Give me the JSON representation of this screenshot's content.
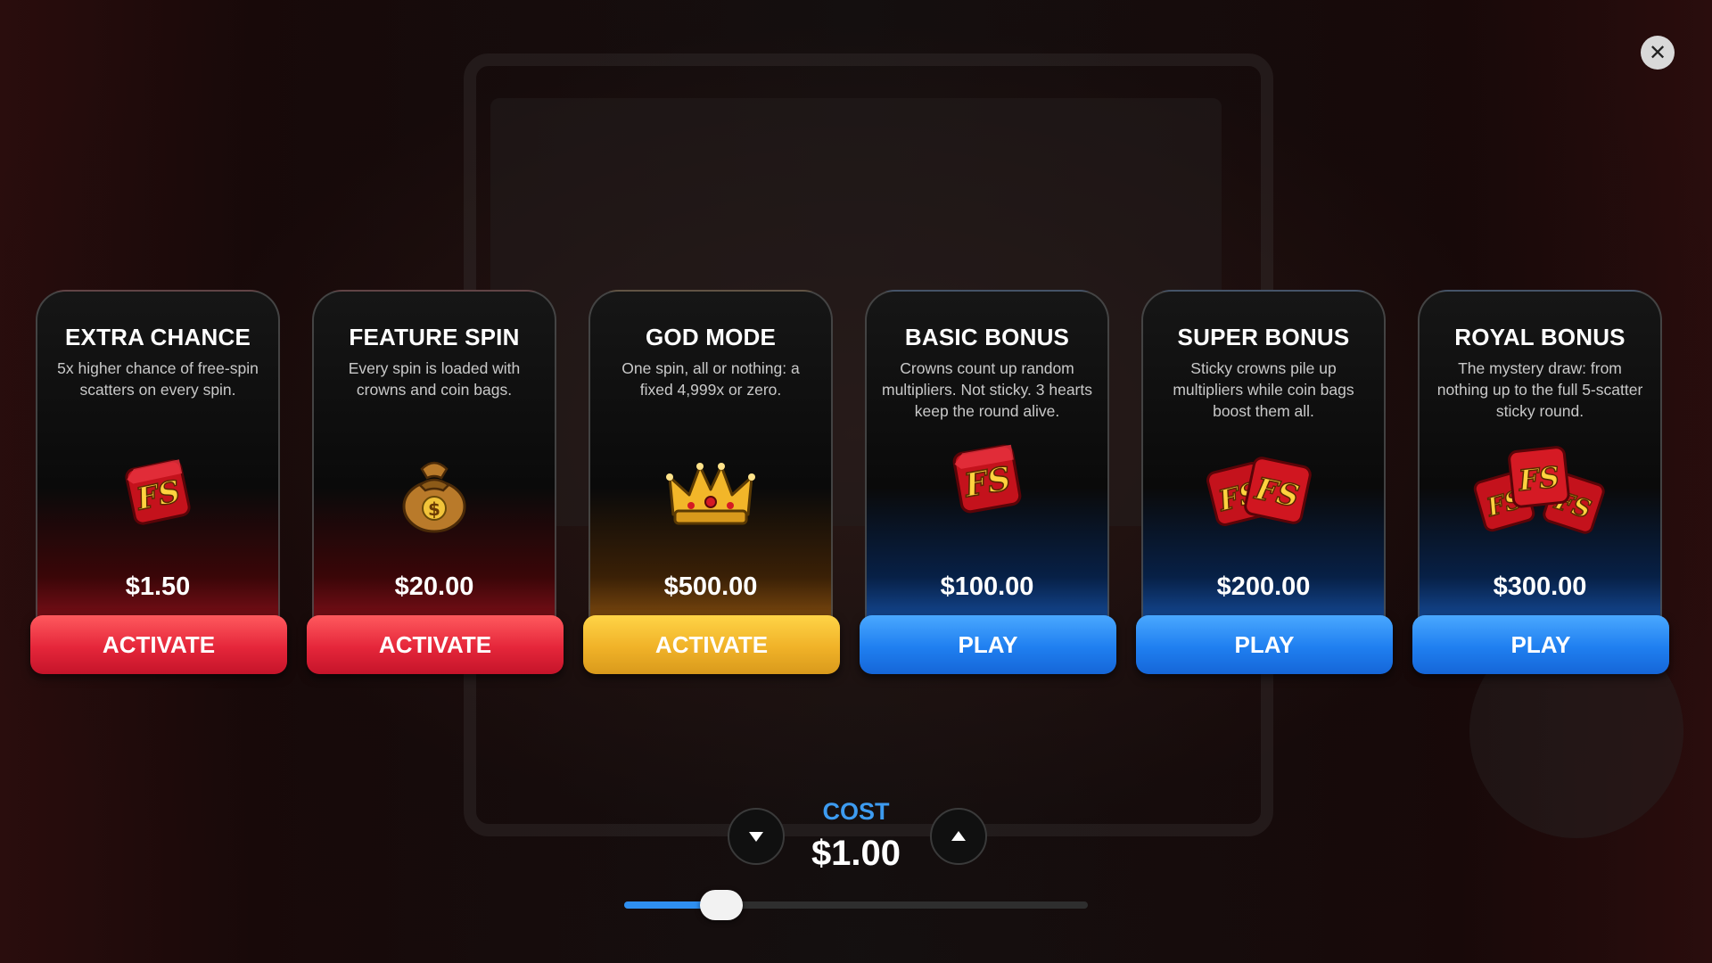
{
  "close": {
    "icon": "close-icon",
    "glyph": "✕"
  },
  "cards": [
    {
      "title": "EXTRA CHANCE",
      "desc": "5x higher chance of free-spin scatters on every spin.",
      "price": "$1.50",
      "button": "ACTIVATE",
      "theme": "red",
      "art": "fs-die-icon"
    },
    {
      "title": "FEATURE SPIN",
      "desc": "Every spin is loaded with crowns and coin bags.",
      "price": "$20.00",
      "button": "ACTIVATE",
      "theme": "red",
      "art": "coin-bag-icon"
    },
    {
      "title": "GOD MODE",
      "desc": "One spin, all or nothing: a fixed 4,999x or zero.",
      "price": "$500.00",
      "button": "ACTIVATE",
      "theme": "gold",
      "art": "crown-icon"
    },
    {
      "title": "BASIC BONUS",
      "desc": "Crowns count up random multipliers. Not sticky. 3 hearts keep the round alive.",
      "price": "$100.00",
      "button": "PLAY",
      "theme": "blue",
      "art": "fs-die-icon"
    },
    {
      "title": "SUPER BONUS",
      "desc": "Sticky crowns pile up multipliers while coin bags boost them all.",
      "price": "$200.00",
      "button": "PLAY",
      "theme": "blue",
      "art": "fs-dice-pair-icon"
    },
    {
      "title": "ROYAL BONUS",
      "desc": "The mystery draw: from nothing up to the full 5-scatter sticky round.",
      "price": "$300.00",
      "button": "PLAY",
      "theme": "blue",
      "art": "fs-dice-triple-icon"
    }
  ],
  "cost": {
    "label": "COST",
    "value": "$1.00",
    "slider_fraction": 0.18,
    "decrease_icon": "chevron-down-icon",
    "increase_icon": "chevron-up-icon"
  },
  "colors": {
    "red_button": "#e5263a",
    "gold_button": "#f0b228",
    "blue_button": "#1f7ff0",
    "cost_label": "#3d9bf0"
  }
}
